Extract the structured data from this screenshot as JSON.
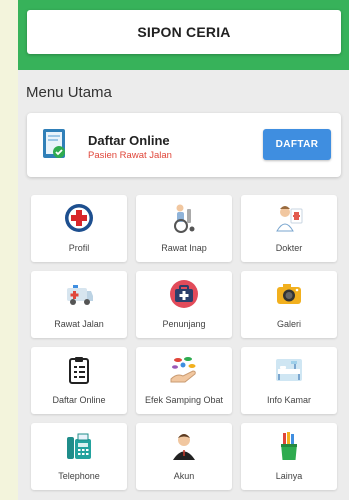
{
  "header": {
    "title": "SIPON CERIA"
  },
  "section_title": "Menu Utama",
  "registration": {
    "title": "Daftar Online",
    "subtitle": "Pasien Rawat Jalan",
    "button_label": "DAFTAR"
  },
  "menu": [
    {
      "label": "Profil",
      "icon": "medical-cross-icon"
    },
    {
      "label": "Rawat Inap",
      "icon": "wheelchair-icon"
    },
    {
      "label": "Dokter",
      "icon": "doctor-icon"
    },
    {
      "label": "Rawat Jalan",
      "icon": "ambulance-icon"
    },
    {
      "label": "Penunjang",
      "icon": "medical-bag-icon"
    },
    {
      "label": "Galeri",
      "icon": "camera-icon"
    },
    {
      "label": "Daftar Online",
      "icon": "clipboard-icon"
    },
    {
      "label": "Efek Samping Obat",
      "icon": "pills-hand-icon"
    },
    {
      "label": "Info Kamar",
      "icon": "hospital-bed-icon"
    },
    {
      "label": "Telephone",
      "icon": "fax-phone-icon"
    },
    {
      "label": "Akun",
      "icon": "user-account-icon"
    },
    {
      "label": "Lainya",
      "icon": "pencil-cup-icon"
    }
  ],
  "colors": {
    "header_bg": "#37b25a",
    "button_bg": "#3f8ee0",
    "subtitle": "#e0463a"
  }
}
